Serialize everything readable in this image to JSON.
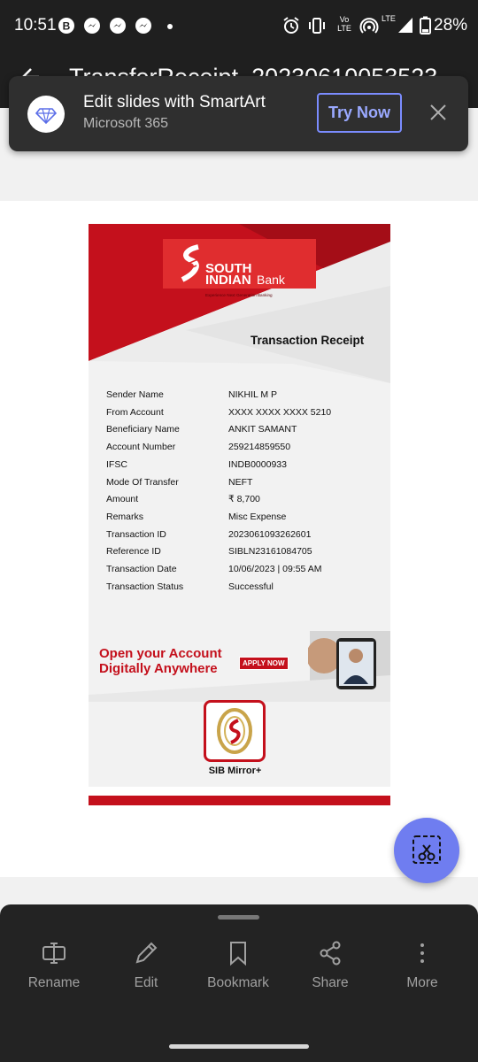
{
  "status_bar": {
    "time": "10:51",
    "network_label_top": "Vo",
    "network_label_bottom": "LTE",
    "lte_label": "LTE",
    "battery": "28%"
  },
  "title_bar": {
    "title": "TransferReceipt_20230610053523"
  },
  "notification": {
    "title": "Edit slides with SmartArt",
    "subtitle": "Microsoft 365",
    "action": "Try Now"
  },
  "receipt": {
    "bank_line1": "SOUTH",
    "bank_line2": "INDIAN",
    "bank_word": "Bank",
    "tagline": "Experience Next Generation Banking",
    "heading": "Transaction Receipt",
    "rows": [
      {
        "label": "Sender Name",
        "value": "NIKHIL M P"
      },
      {
        "label": "From Account",
        "value": "XXXX XXXX XXXX 5210"
      },
      {
        "label": "Beneficiary Name",
        "value": "ANKIT SAMANT"
      },
      {
        "label": "Account Number",
        "value": "259214859550"
      },
      {
        "label": "IFSC",
        "value": "INDB0000933"
      },
      {
        "label": "Mode Of Transfer",
        "value": "NEFT"
      },
      {
        "label": "Amount",
        "value": "₹ 8,700"
      },
      {
        "label": "Remarks",
        "value": "Misc Expense"
      },
      {
        "label": "Transaction ID",
        "value": "2023061093262601"
      },
      {
        "label": "Reference ID",
        "value": "SIBLN23161084705"
      },
      {
        "label": "Transaction Date",
        "value": "10/06/2023 | 09:55 AM"
      },
      {
        "label": "Transaction Status",
        "value": "Successful"
      }
    ],
    "promo_line1": "Open your Account",
    "promo_line2": "Digitally Anywhere",
    "promo_button": "APPLY NOW",
    "app_name": "SIB Mirror+"
  },
  "actions": [
    {
      "label": "Rename",
      "icon": "rename-icon"
    },
    {
      "label": "Edit",
      "icon": "pencil-icon"
    },
    {
      "label": "Bookmark",
      "icon": "bookmark-icon"
    },
    {
      "label": "Share",
      "icon": "share-icon"
    },
    {
      "label": "More",
      "icon": "more-vertical-icon"
    }
  ],
  "colors": {
    "brand_red": "#c4101c",
    "accent": "#6f7df0"
  }
}
